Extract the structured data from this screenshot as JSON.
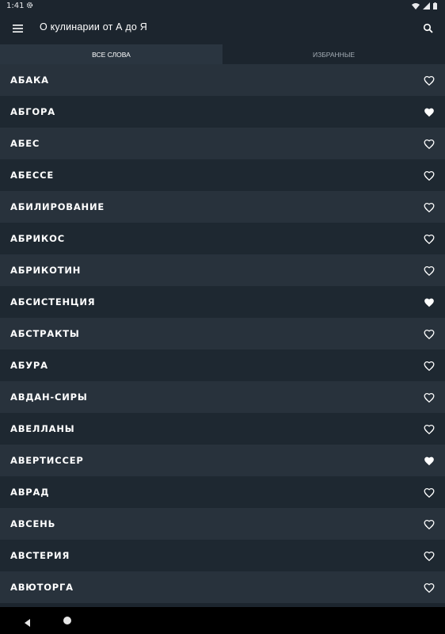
{
  "status": {
    "time": "1:41",
    "icons": [
      "gear-icon",
      "wifi-icon",
      "signal-icon",
      "battery-icon"
    ]
  },
  "appbar": {
    "title": "О кулинарии от А до Я",
    "menu_icon": "hamburger-menu-icon",
    "search_icon": "search-icon"
  },
  "tabs": [
    {
      "label": "ВСЕ СЛОВА",
      "active": true
    },
    {
      "label": "ИЗБРАННЫЕ",
      "active": false
    }
  ],
  "words": [
    {
      "word": "АБАКА",
      "favorite": false
    },
    {
      "word": "АБГОРА",
      "favorite": true
    },
    {
      "word": "АБЕС",
      "favorite": false
    },
    {
      "word": "АБЕССЕ",
      "favorite": false
    },
    {
      "word": "АБИЛИРОВАНИЕ",
      "favorite": false
    },
    {
      "word": "АБРИКОС",
      "favorite": false
    },
    {
      "word": "АБРИКОТИН",
      "favorite": false
    },
    {
      "word": "АБСИСТЕНЦИЯ",
      "favorite": true
    },
    {
      "word": "АБСТРАКТЫ",
      "favorite": false
    },
    {
      "word": "АБУРА",
      "favorite": false
    },
    {
      "word": "АВДАН-СИРЫ",
      "favorite": false
    },
    {
      "word": "АВЕЛЛАНЫ",
      "favorite": false
    },
    {
      "word": "АВЕРТИССЕР",
      "favorite": true
    },
    {
      "word": "АВРАД",
      "favorite": false
    },
    {
      "word": "АВСЕНЬ",
      "favorite": false
    },
    {
      "word": "АВСТЕРИЯ",
      "favorite": false
    },
    {
      "word": "АВЮТОРГА",
      "favorite": false
    }
  ],
  "colors": {
    "background": "#1c252e",
    "row_even": "#28323c",
    "row_odd": "#1e2831",
    "text": "#ffffff",
    "tab_inactive_text": "#a4adb5"
  },
  "navbar": {
    "buttons": [
      "back-icon",
      "home-icon"
    ]
  }
}
